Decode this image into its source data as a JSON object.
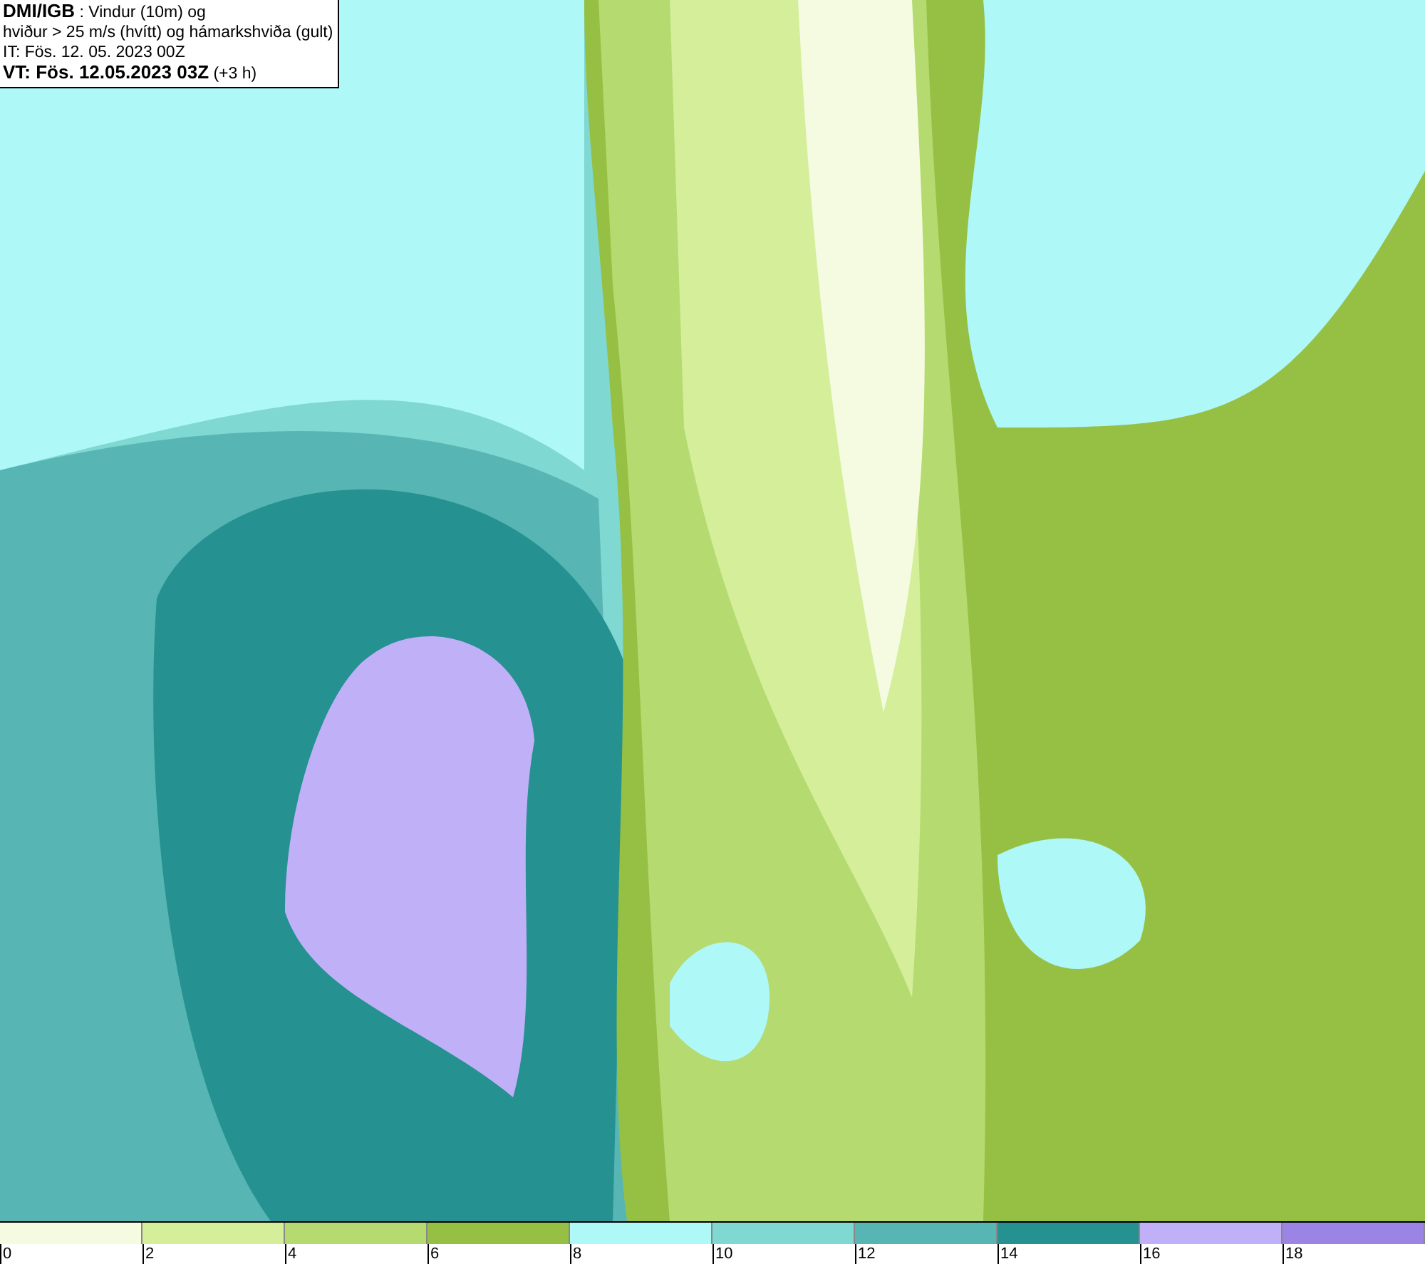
{
  "header": {
    "lines": [
      "**DMI/IGB** : Vindur (10m) og",
      "hviður > 25 m/s (hvítt) og hámarkshviða (gult)",
      "IT: Fös. 12. 05. 2023 00Z",
      "**VT: Fös. 12.05.2023 03Z** (+3 h)"
    ]
  },
  "legend": {
    "swatches": [
      {
        "color": "#f5fbe0"
      },
      {
        "color": "#d4ee9a"
      },
      {
        "color": "#b5da70"
      },
      {
        "color": "#96c043"
      },
      {
        "color": "#aef8f8"
      },
      {
        "color": "#7fd8d2"
      },
      {
        "color": "#57b6b4"
      },
      {
        "color": "#269191"
      },
      {
        "color": "#c0b0f8"
      },
      {
        "color": "#9b84e4"
      }
    ],
    "ticks": [
      "0",
      "2",
      "4",
      "6",
      "8",
      "10",
      "12",
      "14",
      "16",
      "18"
    ]
  }
}
